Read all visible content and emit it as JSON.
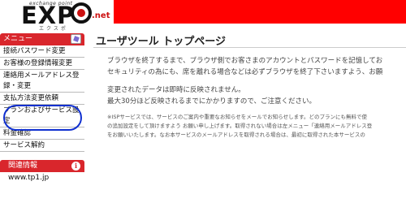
{
  "logo": {
    "subtitle": "exchange point",
    "kana": "エクスポ",
    "text": "EXP",
    "domain": ".net"
  },
  "colors": {
    "header_bar": "#ff0000",
    "menu_header": "#d9262c",
    "highlight_ring": "#1030d0"
  },
  "sidebar": {
    "menu_title": "メニュー",
    "items": [
      {
        "label": "接続パスワード変更"
      },
      {
        "label": "お客様の登録情報変更"
      },
      {
        "label_line1": "連絡用メールアドレス登",
        "label_line2": "録・変更"
      },
      {
        "label": "支払方法変更依頼"
      },
      {
        "label_line1": "プランおよびサービス設",
        "label_line2": "定"
      },
      {
        "label": "料金確認"
      },
      {
        "label": "サービス解約"
      }
    ],
    "related_title": "関連情報",
    "related_links": [
      {
        "label": "www.tp1.jp"
      }
    ]
  },
  "main": {
    "title": "ユーザツール トップページ",
    "paragraph1_line1": "ブラウザを終了するまで、ブラウザ側でお客さまのアカウントとパスワードを記憶してお",
    "paragraph1_line2": "セキュリティの為にも、席を離れる場合などは必ずブラウザを終了下さいますよう、お願",
    "paragraph2_line1": "変更されたデータは即時に反映されません。",
    "paragraph2_line2": "最大30分ほど反映されるまでにかかりますので、ご注意ください。",
    "note_line1": "※ISPサービスでは、サービスのご案内や重要なお知らせをメールでお知らせします。どのプランにも無料で使",
    "note_line2": "の追加設定をして頂けますよう お願い申し上げます。取得されない場合は左メニュー「連絡用メールアドレス登",
    "note_line3": "をお願いいたします。なお本サービスのメールアドレスを取得される場合は、最初に取得された本サービスの"
  }
}
